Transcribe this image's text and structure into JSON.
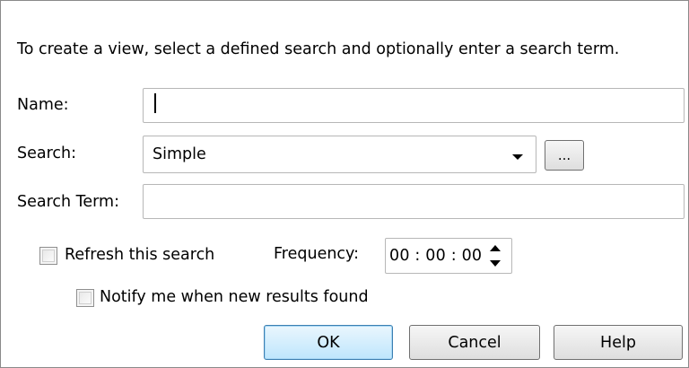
{
  "dialog": {
    "instructions": "To create a view, select a defined search and optionally enter a search term."
  },
  "fields": {
    "name_label": "Name:",
    "name_value": "",
    "search_label": "Search:",
    "search_value": "Simple",
    "browse_label": "...",
    "search_term_label": "Search Term:",
    "search_term_value": ""
  },
  "options": {
    "refresh_label": "Refresh this search",
    "refresh_checked": false,
    "frequency_label": "Frequency:",
    "frequency_value": "00 : 00 : 00",
    "notify_label": "Notify me when new results found",
    "notify_checked": false
  },
  "buttons": {
    "ok": "OK",
    "cancel": "Cancel",
    "help": "Help"
  }
}
